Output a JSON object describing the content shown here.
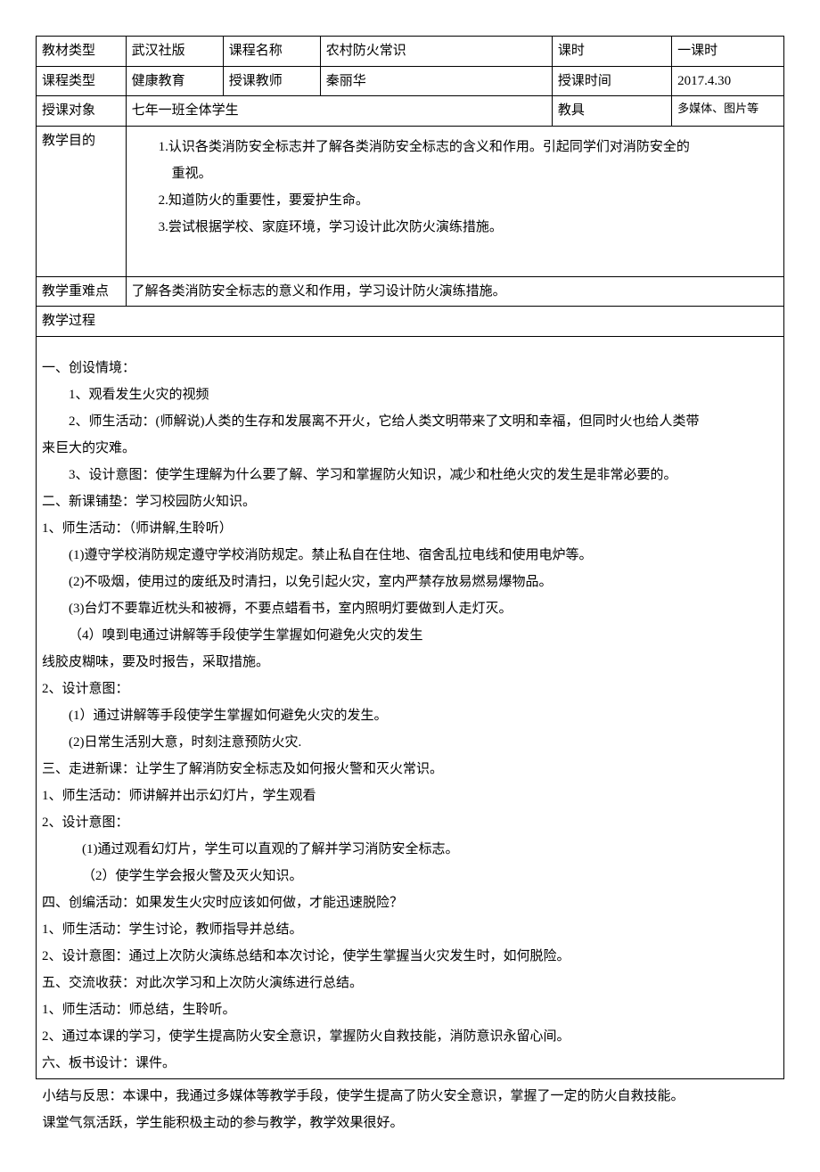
{
  "header": {
    "row1": {
      "c1_label": "教材类型",
      "c1_val": "武汉社版",
      "c2_label": "课程名称",
      "c2_val": "农村防火常识",
      "c3_label": "课时",
      "c3_val": "一课时"
    },
    "row2": {
      "c1_label": "课程类型",
      "c1_val": "健康教育",
      "c2_label": "授课教师",
      "c2_val": "秦丽华",
      "c3_label": "授课时间",
      "c3_val": "2017.4.30"
    },
    "row3": {
      "c1_label": "授课对象",
      "c1_val": "七年一班全体学生",
      "c3_label": "教具",
      "c3_val": "多媒体、图片等"
    }
  },
  "purpose": {
    "label": "教学目的",
    "p1": "1.认识各类消防安全标志并了解各类消防安全标志的含义和作用。引起同学们对消防安全的",
    "p1b": "重视。",
    "p2": "2.知道防火的重要性，要爱护生命。",
    "p3": "3.尝试根据学校、家庭环境，学习设计此次防火演练措施。"
  },
  "keypoint": {
    "label": "教学重难点",
    "val": "了解各类消防安全标志的意义和作用，学习设计防火演练措施。"
  },
  "process": {
    "label": "教学过程",
    "lines": {
      "l01": "一、创设情境：",
      "l02": "1、观看发生火灾的视频",
      "l03": "2、师生活动：(师解说)人类的生存和发展离不开火，它给人类文明带来了文明和幸福，但同时火也给人类带",
      "l04": "来巨大的灾难。",
      "l05": "3、设计意图：使学生理解为什么要了解、学习和掌握防火知识，减少和杜绝火灾的发生是非常必要的。",
      "l06": "二、新课铺垫：学习校园防火知识。",
      "l07": "1、师生活动：（师讲解,生聆听）",
      "l08": "(1)遵守学校消防规定遵守学校消防规定。禁止私自在住地、宿舍乱拉电线和使用电炉等。",
      "l09": "(2)不吸烟，使用过的废纸及时清扫，以免引起火灾，室内严禁存放易燃易爆物品。",
      "l10": "(3)台灯不要靠近枕头和被褥，不要点蜡看书，室内照明灯要做到人走灯灭。",
      "l11": "（4）嗅到电通过讲解等手段使学生掌握如何避免火灾的发生",
      "l12": "线胶皮糊味，要及时报告，采取措施。",
      "l13": "2、设计意图：",
      "l14": "(1）通过讲解等手段使学生掌握如何避免火灾的发生。",
      "l15": "(2)日常生活别大意，时刻注意预防火灾.",
      "l16": "三、走进新课：让学生了解消防安全标志及如何报火警和灭火常识。",
      "l17": "1、师生活动：师讲解并出示幻灯片，学生观看",
      "l18": "2、设计意图：",
      "l19": "(1)通过观看幻灯片，学生可以直观的了解并学习消防安全标志。",
      "l20": "（2）使学生学会报火警及灭火知识。",
      "l21": "四、创编活动：如果发生火灾时应该如何做，才能迅速脱险？",
      "l22": "1、师生活动：学生讨论，教师指导并总结。",
      "l23": "2、设计意图：通过上次防火演练总结和本次讨论，使学生掌握当火灾发生时，如何脱险。",
      "l24": "五、交流收获：对此次学习和上次防火演练进行总结。",
      "l25": "1、师生活动：师总结，生聆听。",
      "l26": "2、通过本课的学习，使学生提高防火安全意识，掌握防火自救技能，消防意识永留心间。",
      "l27": "六、板书设计：课件。"
    }
  },
  "summary": {
    "s1": "小结与反思：本课中，我通过多媒体等教学手段，使学生提高了防火安全意识，掌握了一定的防火自救技能。",
    "s2": "课堂气氛活跃，学生能积极主动的参与教学，教学效果很好。"
  }
}
